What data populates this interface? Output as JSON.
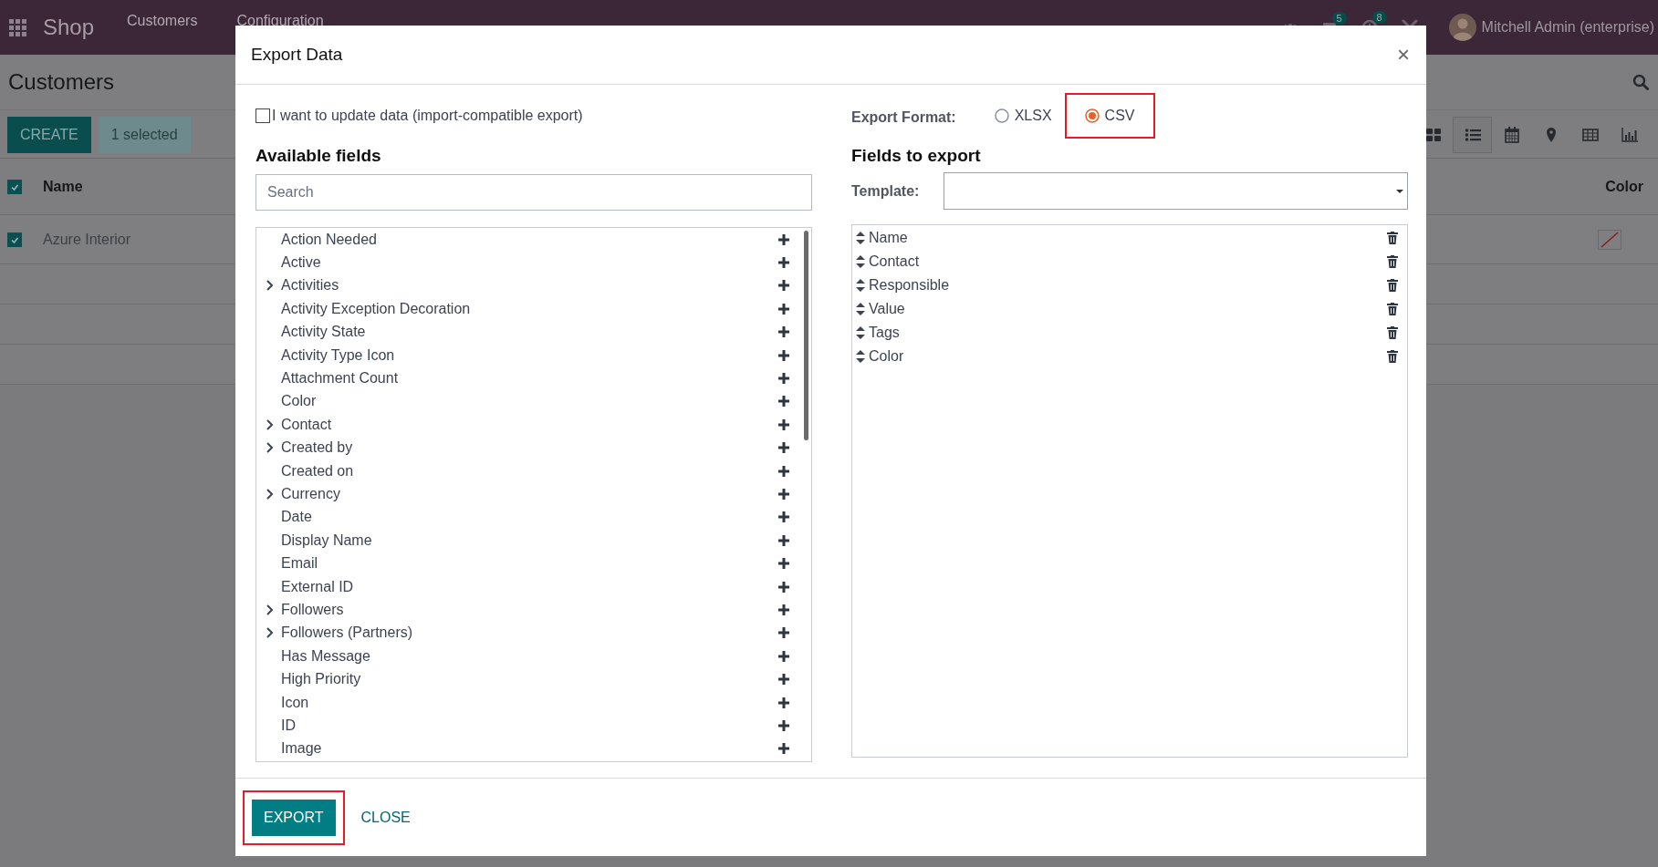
{
  "topbar": {
    "app": "Shop",
    "menu": [
      {
        "label": "Customers"
      },
      {
        "label": "Configuration"
      }
    ],
    "systray": [
      {
        "kind": "bug"
      },
      {
        "kind": "chat",
        "count": "5"
      },
      {
        "kind": "activity",
        "count": "8"
      },
      {
        "kind": "tools"
      }
    ],
    "user": "Mitchell Admin (enterprise)"
  },
  "control_panel": {
    "title": "Customers",
    "buttons": [
      {
        "label": "CREATE",
        "kind": "primary"
      },
      {
        "label": "1 selected",
        "kind": "secondary"
      }
    ],
    "views": [
      {
        "kind": "kanban",
        "selected": false
      },
      {
        "kind": "list",
        "selected": true
      },
      {
        "kind": "calendar",
        "selected": false
      },
      {
        "kind": "map",
        "selected": false
      },
      {
        "kind": "pivot",
        "selected": false
      },
      {
        "kind": "graph",
        "selected": false
      }
    ]
  },
  "list": {
    "columns": [
      "Name",
      "Color"
    ],
    "header_checked": true,
    "rows": [
      {
        "name": "Azure Interior",
        "checked": true
      }
    ]
  },
  "dialog": {
    "title": "Export Data",
    "close": "×",
    "import_compatible": {
      "label": "I want to update data (import-compatible export)",
      "checked": false
    },
    "available_heading": "Available fields",
    "search": {
      "placeholder": "Search"
    },
    "available_fields": [
      {
        "label": "Action Needed",
        "expandable": false
      },
      {
        "label": "Active",
        "expandable": false
      },
      {
        "label": "Activities",
        "expandable": true
      },
      {
        "label": "Activity Exception Decoration",
        "expandable": false
      },
      {
        "label": "Activity State",
        "expandable": false
      },
      {
        "label": "Activity Type Icon",
        "expandable": false
      },
      {
        "label": "Attachment Count",
        "expandable": false
      },
      {
        "label": "Color",
        "expandable": false
      },
      {
        "label": "Contact",
        "expandable": true
      },
      {
        "label": "Created by",
        "expandable": true
      },
      {
        "label": "Created on",
        "expandable": false
      },
      {
        "label": "Currency",
        "expandable": true
      },
      {
        "label": "Date",
        "expandable": false
      },
      {
        "label": "Display Name",
        "expandable": false
      },
      {
        "label": "Email",
        "expandable": false
      },
      {
        "label": "External ID",
        "expandable": false
      },
      {
        "label": "Followers",
        "expandable": true
      },
      {
        "label": "Followers (Partners)",
        "expandable": true
      },
      {
        "label": "Has Message",
        "expandable": false
      },
      {
        "label": "High Priority",
        "expandable": false
      },
      {
        "label": "Icon",
        "expandable": false
      },
      {
        "label": "ID",
        "expandable": false
      },
      {
        "label": "Image",
        "expandable": false
      }
    ],
    "format_label": "Export Format:",
    "formats": [
      {
        "label": "XLSX",
        "selected": false,
        "highlighted": false
      },
      {
        "label": "CSV",
        "selected": true,
        "highlighted": true
      }
    ],
    "export_heading": "Fields to export",
    "template_label": "Template:",
    "fields_to_export": [
      "Name",
      "Contact",
      "Responsible",
      "Value",
      "Tags",
      "Color"
    ],
    "buttons": [
      {
        "label": "EXPORT",
        "kind": "primary",
        "highlighted": true
      },
      {
        "label": "CLOSE",
        "kind": "link",
        "highlighted": false
      }
    ]
  }
}
